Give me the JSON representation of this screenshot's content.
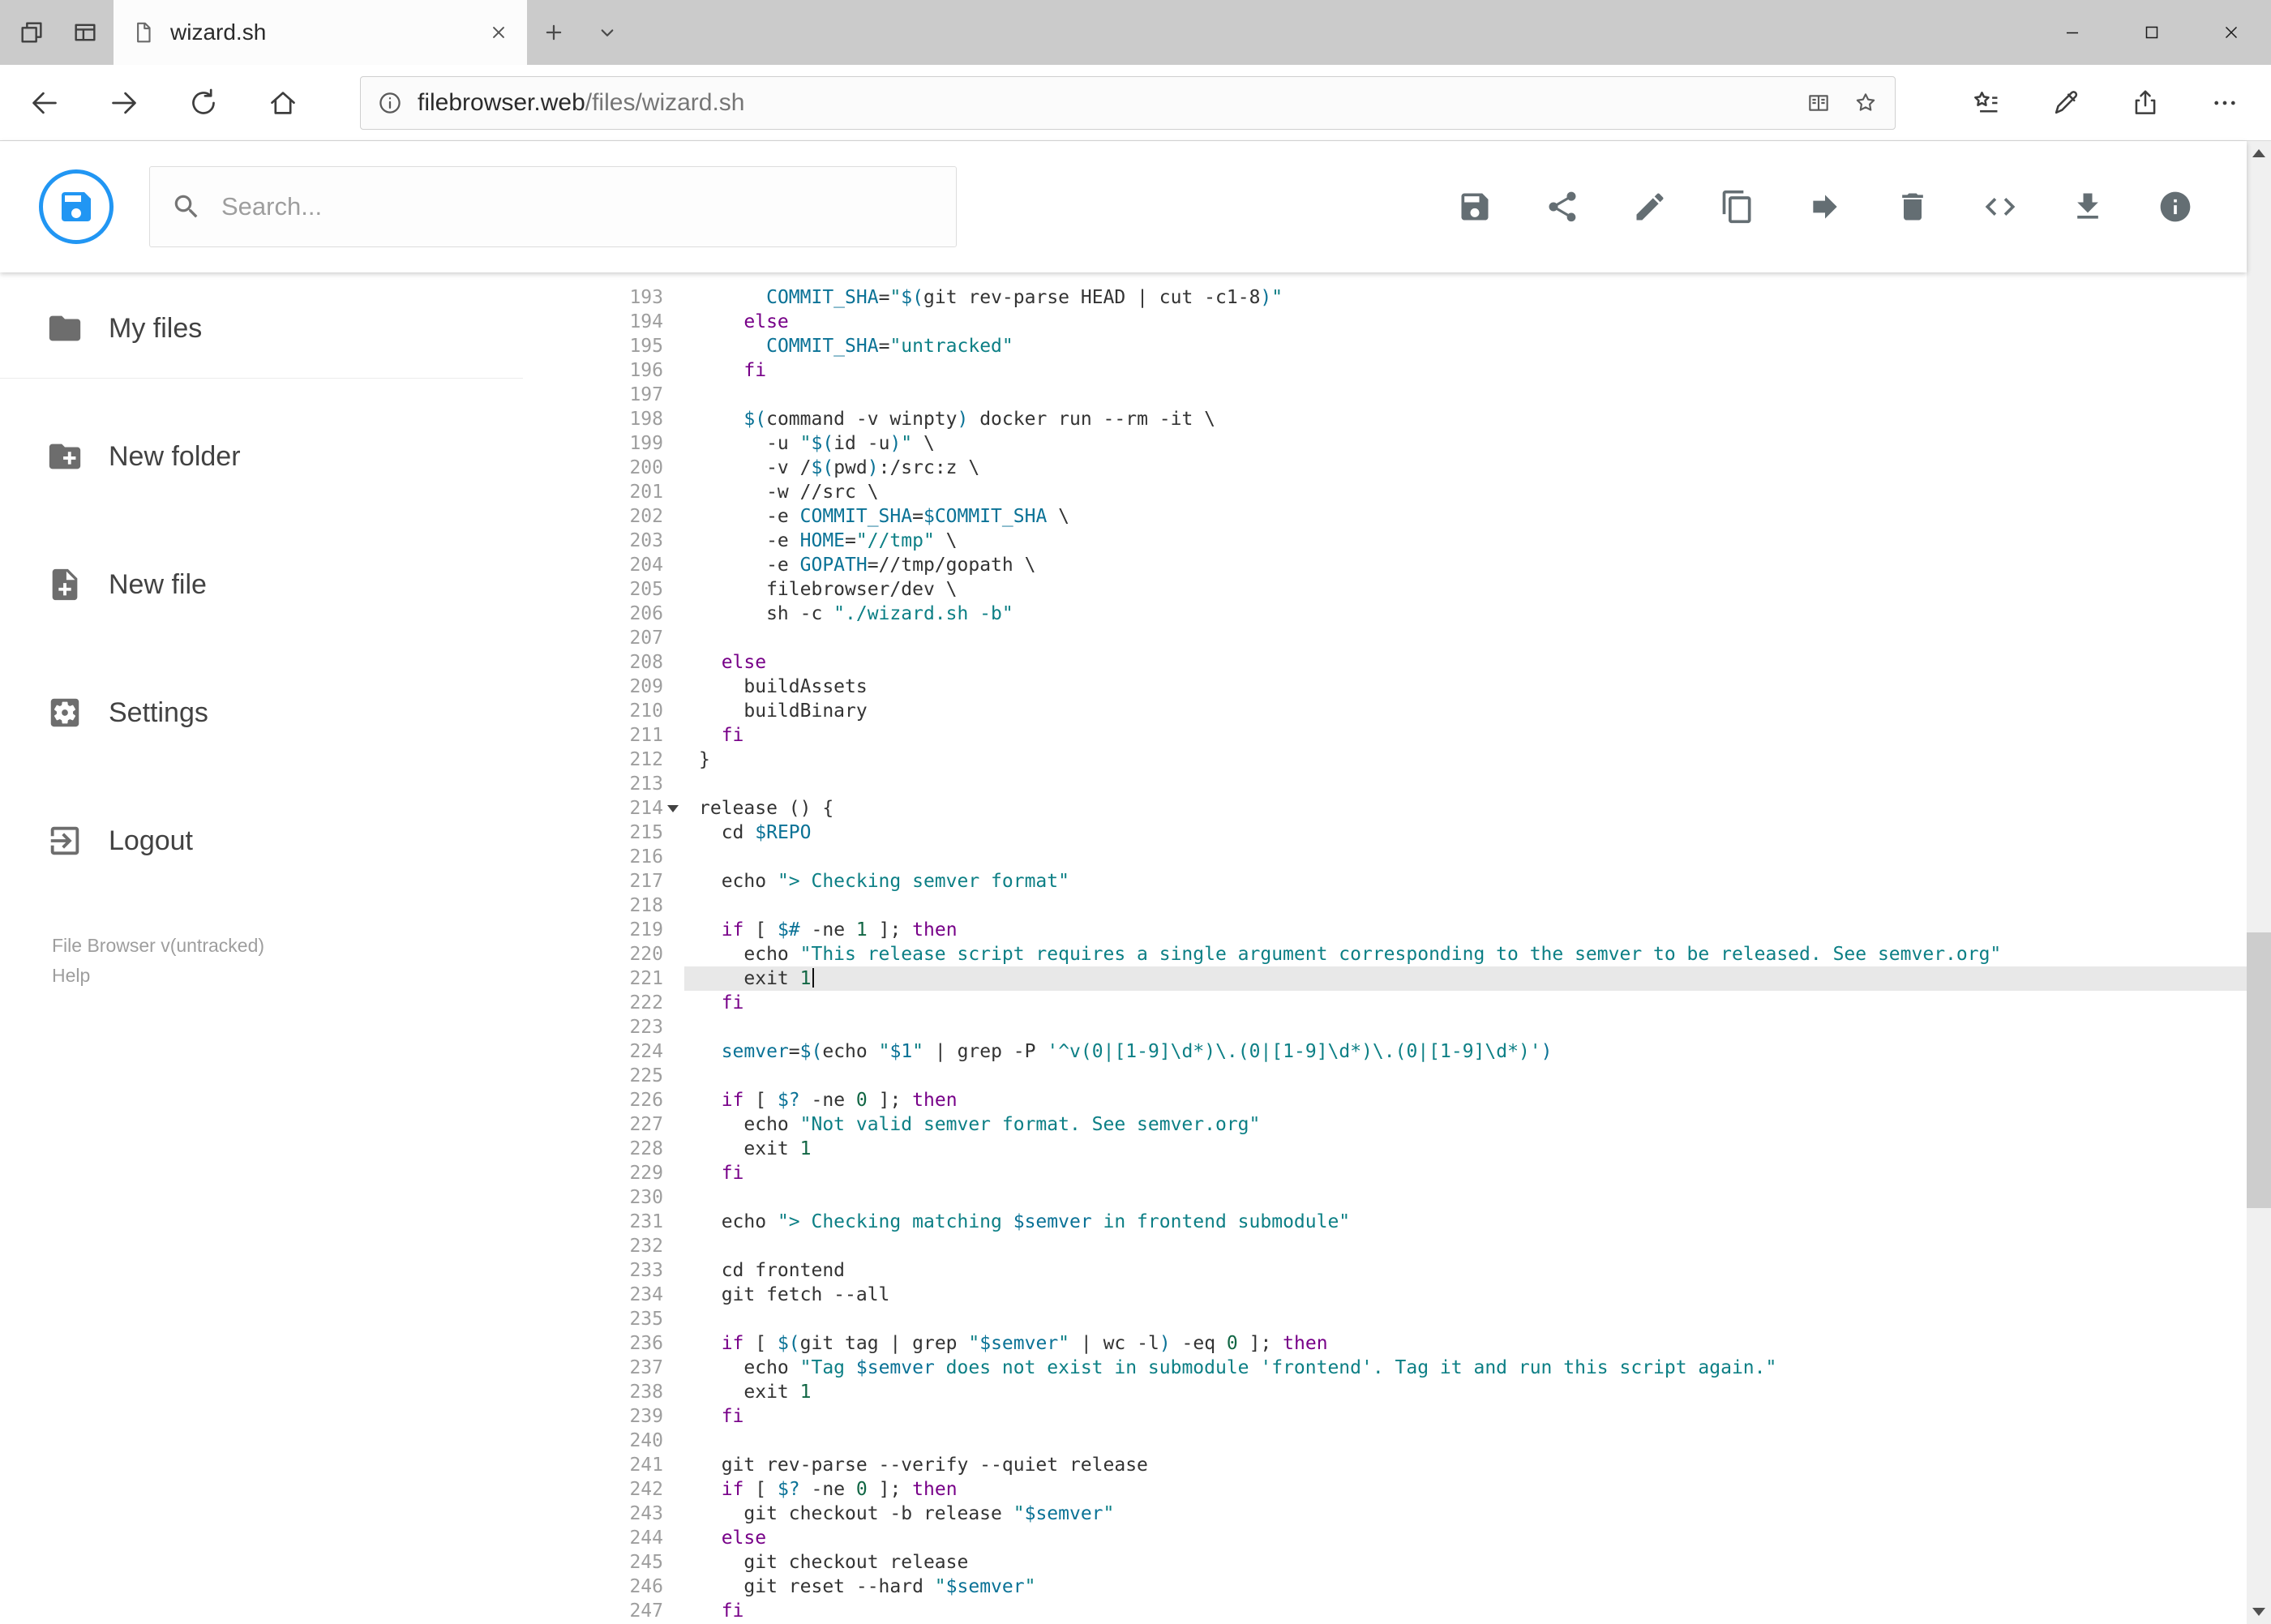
{
  "colors": {
    "accent_blue": "#2196f3",
    "chrome_gray": "#cbcbcb",
    "syntax_keyword": "#770088",
    "syntax_string": "#0c7f85",
    "syntax_variable": "#0a7296",
    "syntax_number": "#116644",
    "line_highlight": "#e8e8e8"
  },
  "browser": {
    "tab_title": "wizard.sh",
    "url_host": "filebrowser.web",
    "url_path": "/files/wizard.sh",
    "chrome_icons": [
      "set-tabs-aside-icon",
      "tab-preview-icon",
      "page-favicon-icon",
      "tab-close-icon",
      "new-tab-icon",
      "tab-list-chevron-icon",
      "minimize-icon",
      "maximize-icon",
      "close-icon",
      "back-icon",
      "forward-icon",
      "refresh-icon",
      "home-icon",
      "page-info-icon",
      "reading-view-icon",
      "favorite-star-icon",
      "hub-icon",
      "ink-icon",
      "share-icon",
      "more-icon",
      "scroll-up-icon",
      "scroll-down-icon"
    ]
  },
  "app": {
    "header": {
      "search_placeholder": "Search...",
      "toolbar": [
        "save-icon",
        "share-icon",
        "edit-icon",
        "copy-icon",
        "move-icon",
        "delete-icon",
        "code-icon",
        "download-icon",
        "info-icon"
      ]
    },
    "sidebar": {
      "items": [
        {
          "icon": "folder-icon",
          "label": "My files"
        },
        {
          "icon": "new-folder-icon",
          "label": "New folder"
        },
        {
          "icon": "new-file-icon",
          "label": "New file"
        },
        {
          "icon": "settings-icon",
          "label": "Settings"
        },
        {
          "icon": "logout-icon",
          "label": "Logout"
        }
      ],
      "version": "File Browser v(untracked)",
      "help": "Help"
    },
    "editor": {
      "active_line": 221,
      "lines": [
        {
          "n": 193,
          "t": [
            [
              "p",
              "      "
            ],
            [
              "v",
              "COMMIT_SHA"
            ],
            [
              "p",
              "="
            ],
            [
              "s",
              "\""
            ],
            [
              "v",
              "$("
            ],
            [
              "p",
              "git rev-parse HEAD | cut -c1-8"
            ],
            [
              "v",
              ")"
            ],
            [
              "s",
              "\""
            ]
          ]
        },
        {
          "n": 194,
          "t": [
            [
              "p",
              "    "
            ],
            [
              "k",
              "else"
            ]
          ]
        },
        {
          "n": 195,
          "t": [
            [
              "p",
              "      "
            ],
            [
              "v",
              "COMMIT_SHA"
            ],
            [
              "p",
              "="
            ],
            [
              "s",
              "\"untracked\""
            ]
          ]
        },
        {
          "n": 196,
          "t": [
            [
              "p",
              "    "
            ],
            [
              "k",
              "fi"
            ]
          ]
        },
        {
          "n": 197,
          "t": []
        },
        {
          "n": 198,
          "t": [
            [
              "p",
              "    "
            ],
            [
              "v",
              "$("
            ],
            [
              "p",
              "command -v winpty"
            ],
            [
              "v",
              ")"
            ],
            [
              "p",
              " docker run --rm -it \\"
            ]
          ]
        },
        {
          "n": 199,
          "t": [
            [
              "p",
              "      -u "
            ],
            [
              "s",
              "\""
            ],
            [
              "v",
              "$("
            ],
            [
              "p",
              "id -u"
            ],
            [
              "v",
              ")"
            ],
            [
              "s",
              "\""
            ],
            [
              "p",
              " \\"
            ]
          ]
        },
        {
          "n": 200,
          "t": [
            [
              "p",
              "      -v /"
            ],
            [
              "v",
              "$("
            ],
            [
              "p",
              "pwd"
            ],
            [
              "v",
              ")"
            ],
            [
              "p",
              ":/src:z \\"
            ]
          ]
        },
        {
          "n": 201,
          "t": [
            [
              "p",
              "      -w //src \\"
            ]
          ]
        },
        {
          "n": 202,
          "t": [
            [
              "p",
              "      -e "
            ],
            [
              "v",
              "COMMIT_SHA"
            ],
            [
              "p",
              "="
            ],
            [
              "v",
              "$COMMIT_SHA"
            ],
            [
              "p",
              " \\"
            ]
          ]
        },
        {
          "n": 203,
          "t": [
            [
              "p",
              "      -e "
            ],
            [
              "v",
              "HOME"
            ],
            [
              "p",
              "="
            ],
            [
              "s",
              "\"//tmp\""
            ],
            [
              "p",
              " \\"
            ]
          ]
        },
        {
          "n": 204,
          "t": [
            [
              "p",
              "      -e "
            ],
            [
              "v",
              "GOPATH"
            ],
            [
              "p",
              "=//tmp/gopath \\"
            ]
          ]
        },
        {
          "n": 205,
          "t": [
            [
              "p",
              "      filebrowser/dev \\"
            ]
          ]
        },
        {
          "n": 206,
          "t": [
            [
              "p",
              "      sh -c "
            ],
            [
              "s",
              "\"./wizard.sh -b\""
            ]
          ]
        },
        {
          "n": 207,
          "t": []
        },
        {
          "n": 208,
          "t": [
            [
              "p",
              "  "
            ],
            [
              "k",
              "else"
            ]
          ]
        },
        {
          "n": 209,
          "t": [
            [
              "p",
              "    buildAssets"
            ]
          ]
        },
        {
          "n": 210,
          "t": [
            [
              "p",
              "    buildBinary"
            ]
          ]
        },
        {
          "n": 211,
          "t": [
            [
              "p",
              "  "
            ],
            [
              "k",
              "fi"
            ]
          ]
        },
        {
          "n": 212,
          "t": [
            [
              "p",
              "}"
            ]
          ]
        },
        {
          "n": 213,
          "t": []
        },
        {
          "n": 214,
          "fold": true,
          "t": [
            [
              "p",
              "release () {"
            ]
          ]
        },
        {
          "n": 215,
          "t": [
            [
              "p",
              "  cd "
            ],
            [
              "v",
              "$REPO"
            ]
          ]
        },
        {
          "n": 216,
          "t": []
        },
        {
          "n": 217,
          "t": [
            [
              "p",
              "  echo "
            ],
            [
              "s",
              "\"> Checking semver format\""
            ]
          ]
        },
        {
          "n": 218,
          "t": []
        },
        {
          "n": 219,
          "t": [
            [
              "p",
              "  "
            ],
            [
              "k",
              "if"
            ],
            [
              "p",
              " [ "
            ],
            [
              "v",
              "$#"
            ],
            [
              "p",
              " -ne "
            ],
            [
              "n2",
              "1"
            ],
            [
              "p",
              " ]; "
            ],
            [
              "k",
              "then"
            ]
          ]
        },
        {
          "n": 220,
          "t": [
            [
              "p",
              "    echo "
            ],
            [
              "s",
              "\"This release script requires a single argument corresponding to the semver to be released. See semver.org\""
            ]
          ]
        },
        {
          "n": 221,
          "cursor": true,
          "t": [
            [
              "p",
              "    exit "
            ],
            [
              "n2",
              "1"
            ]
          ]
        },
        {
          "n": 222,
          "t": [
            [
              "p",
              "  "
            ],
            [
              "k",
              "fi"
            ]
          ]
        },
        {
          "n": 223,
          "t": []
        },
        {
          "n": 224,
          "t": [
            [
              "p",
              "  "
            ],
            [
              "v",
              "semver"
            ],
            [
              "p",
              "="
            ],
            [
              "v",
              "$("
            ],
            [
              "p",
              "echo "
            ],
            [
              "s",
              "\""
            ],
            [
              "v",
              "$1"
            ],
            [
              "s",
              "\""
            ],
            [
              "p",
              " | grep -P "
            ],
            [
              "s",
              "'^v(0|[1-9]\\d*)\\.(0|[1-9]\\d*)\\.(0|[1-9]\\d*)'"
            ],
            [
              "v",
              ")"
            ]
          ]
        },
        {
          "n": 225,
          "t": []
        },
        {
          "n": 226,
          "t": [
            [
              "p",
              "  "
            ],
            [
              "k",
              "if"
            ],
            [
              "p",
              " [ "
            ],
            [
              "v",
              "$?"
            ],
            [
              "p",
              " -ne "
            ],
            [
              "n2",
              "0"
            ],
            [
              "p",
              " ]; "
            ],
            [
              "k",
              "then"
            ]
          ]
        },
        {
          "n": 227,
          "t": [
            [
              "p",
              "    echo "
            ],
            [
              "s",
              "\"Not valid semver format. See semver.org\""
            ]
          ]
        },
        {
          "n": 228,
          "t": [
            [
              "p",
              "    exit "
            ],
            [
              "n2",
              "1"
            ]
          ]
        },
        {
          "n": 229,
          "t": [
            [
              "p",
              "  "
            ],
            [
              "k",
              "fi"
            ]
          ]
        },
        {
          "n": 230,
          "t": []
        },
        {
          "n": 231,
          "t": [
            [
              "p",
              "  echo "
            ],
            [
              "s",
              "\"> Checking matching "
            ],
            [
              "v",
              "$semver"
            ],
            [
              "s",
              " in frontend submodule\""
            ]
          ]
        },
        {
          "n": 232,
          "t": []
        },
        {
          "n": 233,
          "t": [
            [
              "p",
              "  cd frontend"
            ]
          ]
        },
        {
          "n": 234,
          "t": [
            [
              "p",
              "  git fetch --all"
            ]
          ]
        },
        {
          "n": 235,
          "t": []
        },
        {
          "n": 236,
          "t": [
            [
              "p",
              "  "
            ],
            [
              "k",
              "if"
            ],
            [
              "p",
              " [ "
            ],
            [
              "v",
              "$("
            ],
            [
              "p",
              "git tag | grep "
            ],
            [
              "s",
              "\""
            ],
            [
              "v",
              "$semver"
            ],
            [
              "s",
              "\""
            ],
            [
              "p",
              " | wc -l"
            ],
            [
              "v",
              ")"
            ],
            [
              "p",
              " -eq "
            ],
            [
              "n2",
              "0"
            ],
            [
              "p",
              " ]; "
            ],
            [
              "k",
              "then"
            ]
          ]
        },
        {
          "n": 237,
          "t": [
            [
              "p",
              "    echo "
            ],
            [
              "s",
              "\"Tag "
            ],
            [
              "v",
              "$semver"
            ],
            [
              "s",
              " does not exist in submodule 'frontend'. Tag it and run this script again.\""
            ]
          ]
        },
        {
          "n": 238,
          "t": [
            [
              "p",
              "    exit "
            ],
            [
              "n2",
              "1"
            ]
          ]
        },
        {
          "n": 239,
          "t": [
            [
              "p",
              "  "
            ],
            [
              "k",
              "fi"
            ]
          ]
        },
        {
          "n": 240,
          "t": []
        },
        {
          "n": 241,
          "t": [
            [
              "p",
              "  git rev-parse --verify --quiet release"
            ]
          ]
        },
        {
          "n": 242,
          "t": [
            [
              "p",
              "  "
            ],
            [
              "k",
              "if"
            ],
            [
              "p",
              " [ "
            ],
            [
              "v",
              "$?"
            ],
            [
              "p",
              " -ne "
            ],
            [
              "n2",
              "0"
            ],
            [
              "p",
              " ]; "
            ],
            [
              "k",
              "then"
            ]
          ]
        },
        {
          "n": 243,
          "t": [
            [
              "p",
              "    git checkout -b release "
            ],
            [
              "s",
              "\""
            ],
            [
              "v",
              "$semver"
            ],
            [
              "s",
              "\""
            ]
          ]
        },
        {
          "n": 244,
          "t": [
            [
              "p",
              "  "
            ],
            [
              "k",
              "else"
            ]
          ]
        },
        {
          "n": 245,
          "t": [
            [
              "p",
              "    git checkout release"
            ]
          ]
        },
        {
          "n": 246,
          "t": [
            [
              "p",
              "    git reset --hard "
            ],
            [
              "s",
              "\""
            ],
            [
              "v",
              "$semver"
            ],
            [
              "s",
              "\""
            ]
          ]
        },
        {
          "n": 247,
          "t": [
            [
              "p",
              "  "
            ],
            [
              "k",
              "fi"
            ]
          ]
        }
      ]
    }
  }
}
